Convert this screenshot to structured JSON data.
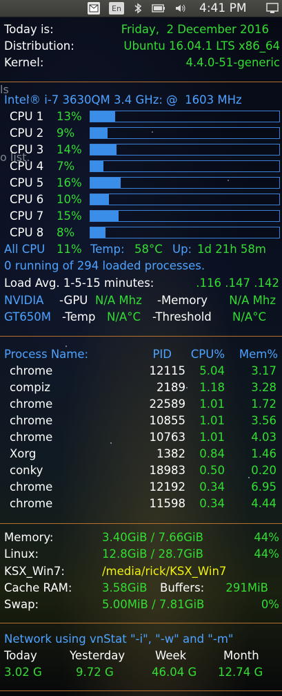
{
  "panel": {
    "lang": "En",
    "clock": "4:41 PM"
  },
  "system": {
    "today_label": "Today is:",
    "today_value": "Friday,  2 December 2016",
    "dist_label": "Distribution:",
    "dist_value": "Ubuntu 16.04.1 LTS x86_64",
    "kernel_label": "Kernel:",
    "kernel_value": "4.4.0-51-generic"
  },
  "cpu": {
    "model": "Intel® i-7 3630QM 3.4 GHz: @  1603 MHz",
    "cores": [
      {
        "label": "CPU 1",
        "value": "13%",
        "fraction": 0.13
      },
      {
        "label": "CPU 2",
        "value": "9%",
        "fraction": 0.09
      },
      {
        "label": "CPU 3",
        "value": "14%",
        "fraction": 0.14
      },
      {
        "label": "CPU 4",
        "value": "7%",
        "fraction": 0.07
      },
      {
        "label": "CPU 5",
        "value": "16%",
        "fraction": 0.16
      },
      {
        "label": "CPU 6",
        "value": "10%",
        "fraction": 0.1
      },
      {
        "label": "CPU 7",
        "value": "15%",
        "fraction": 0.15
      },
      {
        "label": "CPU 8",
        "value": "8%",
        "fraction": 0.08
      }
    ],
    "all_label": "All CPU",
    "all_value": "11%",
    "temp_label": "Temp:",
    "temp_value": "58°C",
    "up_label": "Up:",
    "up_value": "1d 21h 58m",
    "processes": "0 running of 294 loaded processes.",
    "load_label": "Load Avg. 1-5-15 minutes:",
    "load_value": ".116 .147 .142",
    "gpu_name1": "NVIDIA",
    "gpu_label": "-GPU",
    "gpu_value": "N/A Mhz",
    "mem_label": "-Memory",
    "mem_value": "N/A Mhz",
    "gpu_name2": "GT650M",
    "temp2_label": "-Temp",
    "temp2_value": "N/A°C",
    "thr_label": "-Threshold",
    "thr_value": "N/A°C"
  },
  "processes": {
    "headers": [
      "Process Name:",
      "PID",
      "CPU%",
      "Mem%"
    ],
    "rows": [
      [
        "chrome",
        "12115",
        "5.04",
        "3.17"
      ],
      [
        "compiz",
        "2189",
        "1.18",
        "3.28"
      ],
      [
        "chrome",
        "22589",
        "1.01",
        "1.72"
      ],
      [
        "chrome",
        "10855",
        "1.01",
        "3.56"
      ],
      [
        "chrome",
        "10763",
        "1.01",
        "4.03"
      ],
      [
        "Xorg",
        "1382",
        "0.84",
        "1.46"
      ],
      [
        "conky",
        "18983",
        "0.50",
        "0.20"
      ],
      [
        "chrome",
        "12192",
        "0.34",
        "6.95"
      ],
      [
        "chrome",
        "11598",
        "0.34",
        "4.44"
      ]
    ]
  },
  "memory": {
    "mem_label": "Memory:",
    "mem_value": "3.40GiB / 7.66GiB",
    "mem_pct": "44%",
    "linux_label": "Linux:",
    "linux_value": "12.8GiB / 28.7GiB",
    "linux_pct": "44%",
    "ksx_label": "KSX_Win7:",
    "ksx_value": "/media/rick/KSX_Win7",
    "cache_label": "Cache RAM:",
    "cache_value": "3.58GiB",
    "buffers_label": "Buffers:",
    "buffers_value": "291MiB",
    "swap_label": "Swap:",
    "swap_value": "5.00MiB / 7.81GiB",
    "swap_pct": "0%"
  },
  "network": {
    "title": "Network using vnStat \"-i\", \"-w\" and \"-m\"",
    "headers": [
      "Today",
      "Yesterday",
      "Week",
      "Month"
    ],
    "values": [
      "3.02 G",
      "9.72 G",
      "46.04 G",
      "12.74 G"
    ]
  },
  "background": {
    "ghost1": "ls",
    "ghost2": "o list."
  },
  "colors": {
    "label": "#ffffff",
    "value": "#33dd33",
    "heading": "#4da3ff",
    "path": "#f2f20f",
    "divider": "#b5712d",
    "bar": "#3a8ee8"
  }
}
